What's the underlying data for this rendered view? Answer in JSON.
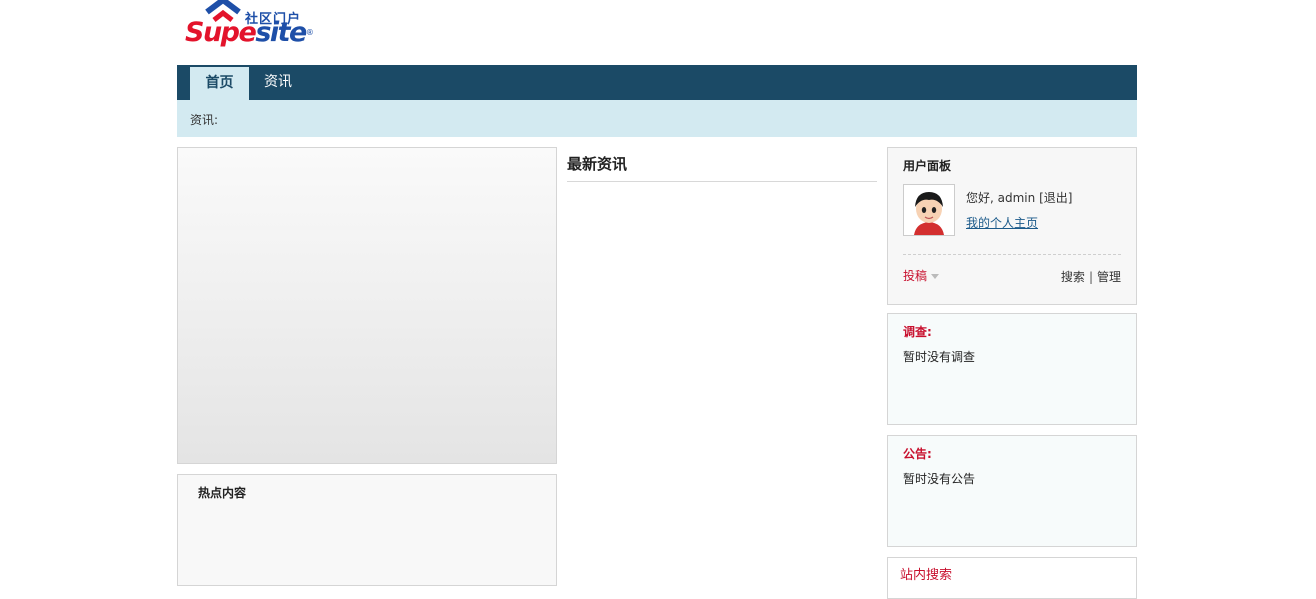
{
  "brand": {
    "tagline": "社区门户",
    "name_part1": "Supe",
    "name_part2": "site",
    "registered": "®",
    "colors": {
      "red": "#e3132b",
      "blue": "#1e4fa8"
    }
  },
  "nav": {
    "items": [
      {
        "label": "首页",
        "active": true
      },
      {
        "label": "资讯",
        "active": false
      }
    ],
    "bar_color": "#1b4a66"
  },
  "subnav": {
    "label": "资讯:"
  },
  "hot": {
    "title": "热点内容"
  },
  "news": {
    "title": "最新资讯"
  },
  "user_panel": {
    "title": "用户面板",
    "greeting_prefix": "您好, admin",
    "logout_label": "[退出]",
    "home_link": "我的个人主页",
    "submit_label": "投稿",
    "search_label": "搜索",
    "separator": "|",
    "manage_label": "管理"
  },
  "poll": {
    "title": "调查:",
    "empty_text": "暂时没有调查"
  },
  "notice": {
    "title": "公告:",
    "empty_text": "暂时没有公告"
  },
  "site_search": {
    "title": "站内搜索"
  },
  "icons": {
    "logo": "house-roof-logo",
    "avatar": "cartoon-avatar-icon",
    "dropdown": "caret-down-icon"
  }
}
